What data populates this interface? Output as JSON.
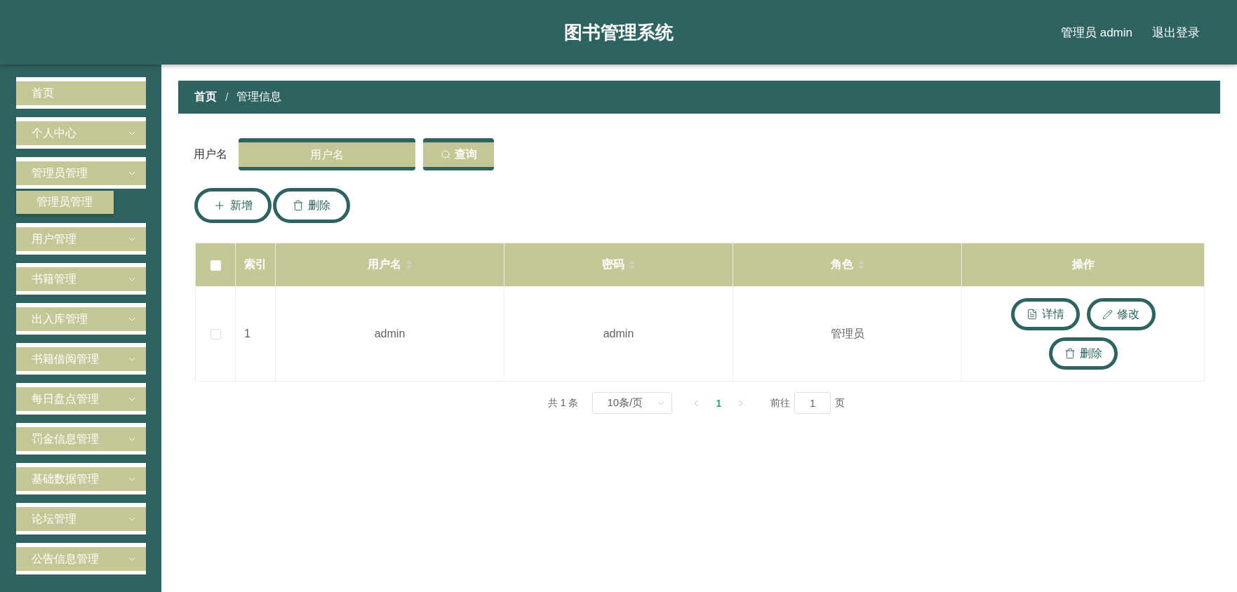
{
  "header": {
    "title": "图书管理系统",
    "user": "管理员 admin",
    "logout": "退出登录"
  },
  "sidebar": {
    "items": [
      {
        "label": "首页",
        "kind": "link"
      },
      {
        "label": "个人中心",
        "kind": "submenu"
      },
      {
        "label": "管理员管理",
        "kind": "submenu",
        "children": [
          {
            "label": "管理员管理"
          }
        ]
      },
      {
        "label": "用户管理",
        "kind": "submenu"
      },
      {
        "label": "书籍管理",
        "kind": "submenu"
      },
      {
        "label": "出入库管理",
        "kind": "submenu"
      },
      {
        "label": "书籍借阅管理",
        "kind": "submenu"
      },
      {
        "label": "每日盘点管理",
        "kind": "submenu"
      },
      {
        "label": "罚金信息管理",
        "kind": "submenu"
      },
      {
        "label": "基础数据管理",
        "kind": "submenu"
      },
      {
        "label": "论坛管理",
        "kind": "submenu"
      },
      {
        "label": "公告信息管理",
        "kind": "submenu"
      }
    ]
  },
  "breadcrumb": {
    "separator": "/",
    "items": [
      {
        "label": "首页",
        "kind": "link"
      },
      {
        "label": "管理信息",
        "kind": "current"
      }
    ]
  },
  "search": {
    "label": "用户名",
    "placeholder": "用户名",
    "button": "查询"
  },
  "actions": [
    {
      "label": "新增",
      "kind": "add"
    },
    {
      "label": "删除",
      "kind": "delete"
    }
  ],
  "table": {
    "select_all": {
      "checked": false
    },
    "columns": [
      {
        "kind": "index",
        "label": "索引",
        "sortable": false
      },
      {
        "kind": "text",
        "label": "用户名",
        "sortable": true
      },
      {
        "kind": "text",
        "label": "密码",
        "sortable": true
      },
      {
        "kind": "text",
        "label": "角色",
        "sortable": true
      },
      {
        "kind": "actions",
        "label": "操作",
        "sortable": false
      }
    ],
    "rows": [
      {
        "checked": false,
        "cells": [
          "1",
          "admin",
          "admin",
          "管理员"
        ],
        "actions": [
          {
            "label": "详情",
            "kind": "detail"
          },
          {
            "label": "修改",
            "kind": "edit"
          },
          {
            "label": "删除",
            "kind": "delete"
          }
        ]
      }
    ]
  },
  "pagination": {
    "total": "共 1 条",
    "page_size": "10条/页",
    "pages": [
      {
        "label": "1",
        "selected": true
      }
    ],
    "goto_label": "前往",
    "goto_value": "1",
    "goto_suffix": "页"
  }
}
